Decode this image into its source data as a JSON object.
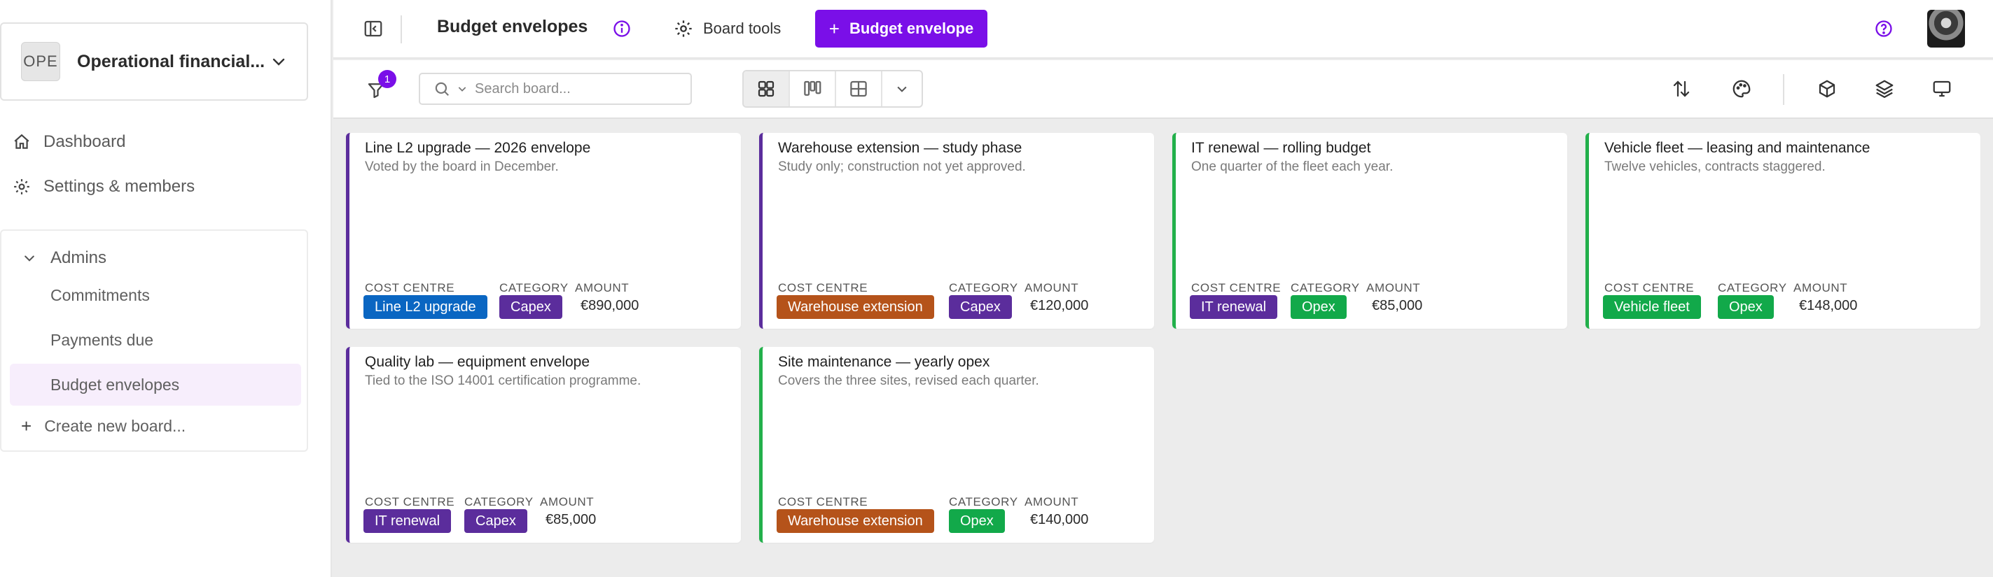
{
  "workspace": {
    "initials": "OPE",
    "name": "Operational financial..."
  },
  "nav": {
    "dashboard": "Dashboard",
    "settings": "Settings & members"
  },
  "group": {
    "title": "Admins",
    "items": [
      "Commitments",
      "Payments due",
      "Budget envelopes"
    ],
    "active_index": 2,
    "create_label": "Create new board..."
  },
  "topbar": {
    "title": "Budget envelopes",
    "board_tools": "Board tools",
    "primary_plus": "+",
    "primary_label": "Budget envelope"
  },
  "toolbar": {
    "filter_count": "1",
    "search_placeholder": "Search board..."
  },
  "field_labels": {
    "cost_centre": "COST CENTRE",
    "category": "CATEGORY",
    "amount": "AMOUNT"
  },
  "colors": {
    "accent": "#7a0fe8",
    "capex_border": "#5b2d9c",
    "opex_border": "#22b04b",
    "tag_line_l2": "#0a66c2",
    "tag_warehouse": "#b5531a",
    "tag_it": "#5b2d9c",
    "tag_vehicle": "#12a94a",
    "tag_capex": "#5b2d9c",
    "tag_opex": "#12a94a"
  },
  "cards": [
    {
      "title": "Line L2 upgrade — 2026 envelope",
      "description": "Voted by the board in December.",
      "cost_centre": "Line L2 upgrade",
      "category": "Capex",
      "amount": "€890,000"
    },
    {
      "title": "Warehouse extension — study phase",
      "description": "Study only; construction not yet approved.",
      "cost_centre": "Warehouse extension",
      "category": "Capex",
      "amount": "€120,000"
    },
    {
      "title": "IT renewal — rolling budget",
      "description": "One quarter of the fleet each year.",
      "cost_centre": "IT renewal",
      "category": "Opex",
      "amount": "€85,000"
    },
    {
      "title": "Vehicle fleet — leasing and maintenance",
      "description": "Twelve vehicles, contracts staggered.",
      "cost_centre": "Vehicle fleet",
      "category": "Opex",
      "amount": "€148,000"
    },
    {
      "title": "Quality lab — equipment envelope",
      "description": "Tied to the ISO 14001 certification programme.",
      "cost_centre": "IT renewal",
      "category": "Capex",
      "amount": "€85,000"
    },
    {
      "title": "Site maintenance — yearly opex",
      "description": "Covers the three sites, revised each quarter.",
      "cost_centre": "Warehouse extension",
      "category": "Opex",
      "amount": "€140,000"
    }
  ]
}
